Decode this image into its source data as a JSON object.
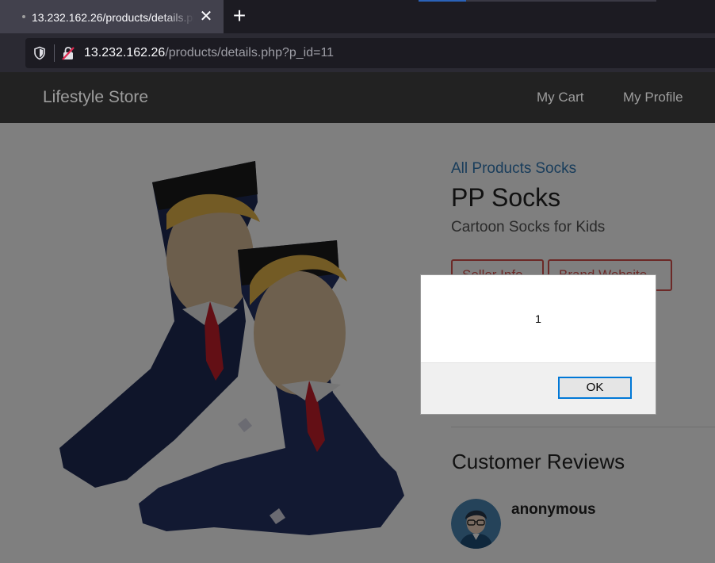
{
  "browser": {
    "tab_title": "13.232.162.26/products/details.php?p_id=11",
    "close_glyph": "✕",
    "new_tab_glyph": "+",
    "url_host": "13.232.162.26",
    "url_path": "/products/details.php?p_id=11",
    "icons": [
      "shield-icon",
      "insecure-connection-icon",
      "close-icon",
      "plus-icon"
    ]
  },
  "header": {
    "brand": "Lifestyle Store",
    "nav": [
      "My Cart",
      "My Profile"
    ]
  },
  "product": {
    "breadcrumb": [
      "All Products",
      "Socks"
    ],
    "title": "PP Socks",
    "subtitle": "Cartoon Socks for Kids",
    "buttons": [
      "Seller Info",
      "Brand Website"
    ],
    "accent_color": "#d9534f",
    "link_color": "#337ab7"
  },
  "reviews": {
    "heading": "Customer Reviews",
    "items": [
      {
        "name": "anonymous"
      }
    ]
  },
  "dialog": {
    "message": "1",
    "ok_label": "OK"
  }
}
